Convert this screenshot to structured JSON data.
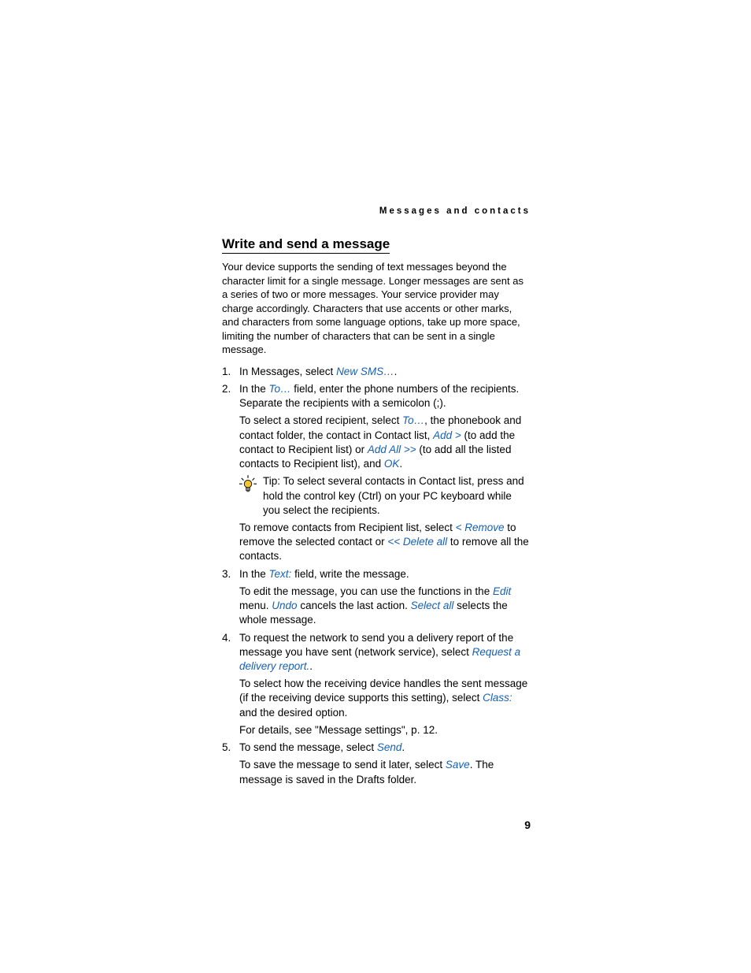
{
  "header": "Messages and contacts",
  "title": "Write and send a message",
  "intro": "Your device supports the sending of text messages beyond the character limit for a single message. Longer messages are sent as a series of two or more messages. Your service provider may charge accordingly. Characters that use accents or other marks, and characters from some language options, take up more space, limiting the number of characters that can be sent in a single message.",
  "step1": {
    "pre": "In Messages, select ",
    "link": "New SMS…",
    "post": "."
  },
  "step2": {
    "p1": {
      "a": "In the ",
      "link1": "To…",
      "b": " field, enter the phone numbers of the recipients. Separate the recipients with a semicolon (;)."
    },
    "p2": {
      "a": "To select a stored recipient, select ",
      "link1": "To…",
      "b": ", the phonebook and contact folder, the contact in Contact list, ",
      "link2": "Add >",
      "c": " (to add the contact to Recipient list) or ",
      "link3": "Add All >>",
      "d": " (to add all the listed contacts to Recipient list), and ",
      "link4": "OK",
      "e": "."
    },
    "tip": "Tip: To select several contacts in Contact list, press and hold the control key (Ctrl) on your PC keyboard while you select the recipients.",
    "p3": {
      "a": "To remove contacts from Recipient list, select ",
      "link1": "< Remove",
      "b": " to remove the selected contact or ",
      "link2": "<< Delete all",
      "c": " to remove all the contacts."
    }
  },
  "step3": {
    "p1": {
      "a": "In the ",
      "link1": "Text:",
      "b": " field, write the message."
    },
    "p2": {
      "a": "To edit the message, you can use the functions in the ",
      "link1": "Edit",
      "b": " menu. ",
      "link2": "Undo",
      "c": " cancels the last action. ",
      "link3": "Select all",
      "d": " selects the whole message."
    }
  },
  "step4": {
    "p1": {
      "a": "To request the network to send you a delivery report of the message you have sent (network service), select ",
      "link1": "Request a delivery report.",
      "b": "."
    },
    "p2": {
      "a": "To select how the receiving device handles the sent message (if the receiving device supports this setting), select ",
      "link1": "Class:",
      "b": " and the desired option."
    },
    "p3": "For details, see \"Message settings\", p. 12."
  },
  "step5": {
    "p1": {
      "a": "To send the message, select ",
      "link1": "Send",
      "b": "."
    },
    "p2": {
      "a": "To save the message to send it later, select ",
      "link1": "Save",
      "b": ". The message is saved in the Drafts folder."
    }
  },
  "pageNumber": "9"
}
